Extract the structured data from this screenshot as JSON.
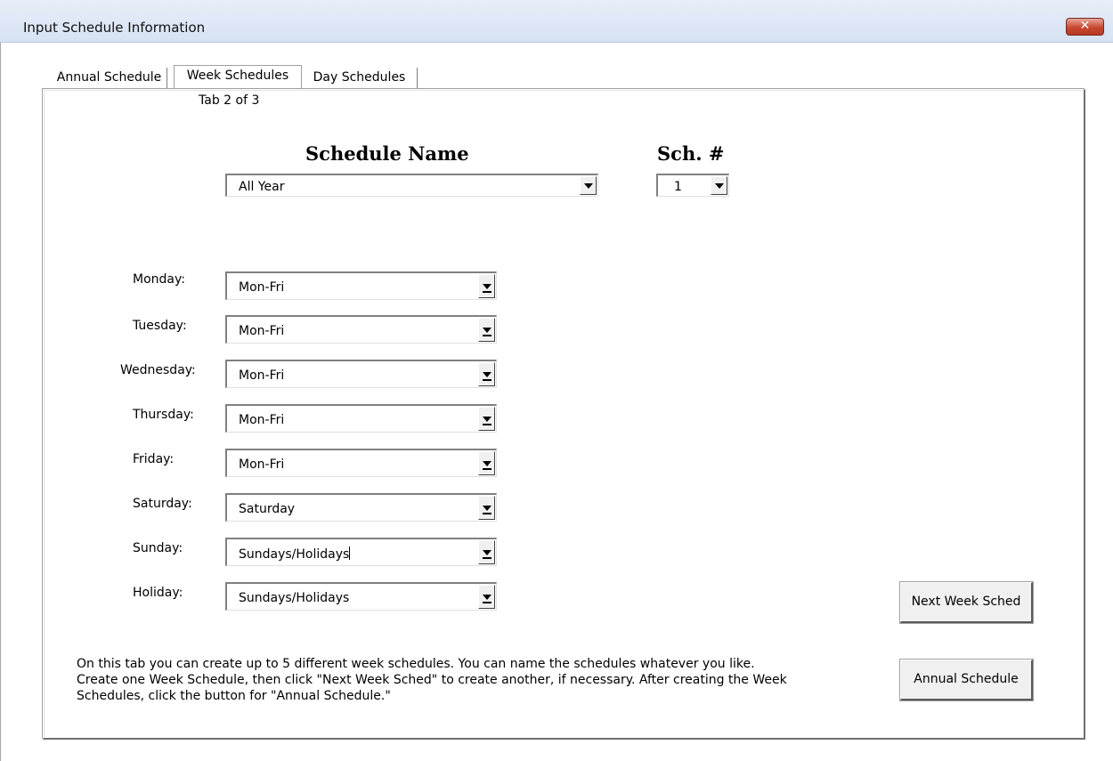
{
  "window": {
    "title": "Input Schedule Information",
    "close_glyph": "✕"
  },
  "tabs": [
    {
      "label": "Annual Schedule",
      "active": false
    },
    {
      "label": "Week Schedules",
      "active": true
    },
    {
      "label": "Day Schedules",
      "active": false
    }
  ],
  "tab_indicator": "Tab 2 of 3",
  "schedule": {
    "name_heading": "Schedule Name",
    "name_value": "All Year",
    "number_heading": "Sch. #",
    "number_value": "1"
  },
  "days": [
    {
      "label": "Monday:",
      "value": "Mon-Fri"
    },
    {
      "label": "Tuesday:",
      "value": "Mon-Fri"
    },
    {
      "label": "Wednesday:",
      "value": "Mon-Fri"
    },
    {
      "label": "Thursday:",
      "value": "Mon-Fri"
    },
    {
      "label": "Friday:",
      "value": "Mon-Fri"
    },
    {
      "label": "Saturday:",
      "value": "Saturday"
    },
    {
      "label": "Sunday:",
      "value": "Sundays/Holidays"
    },
    {
      "label": "Holiday:",
      "value": "Sundays/Holidays"
    }
  ],
  "buttons": {
    "next_week_sched": "Next Week Sched",
    "annual_schedule": "Annual Schedule"
  },
  "help_lines": [
    "On this tab you can create up to 5 different week schedules.  You can name the schedules whatever you like.",
    "Create one Week Schedule, then click \"Next Week Sched\" to create another, if necessary.  After creating the Week",
    "Schedules, click the button for \"Annual Schedule.\""
  ],
  "colors": {
    "close_button": "#c9472f",
    "titlebar": "#dbe6f4"
  }
}
